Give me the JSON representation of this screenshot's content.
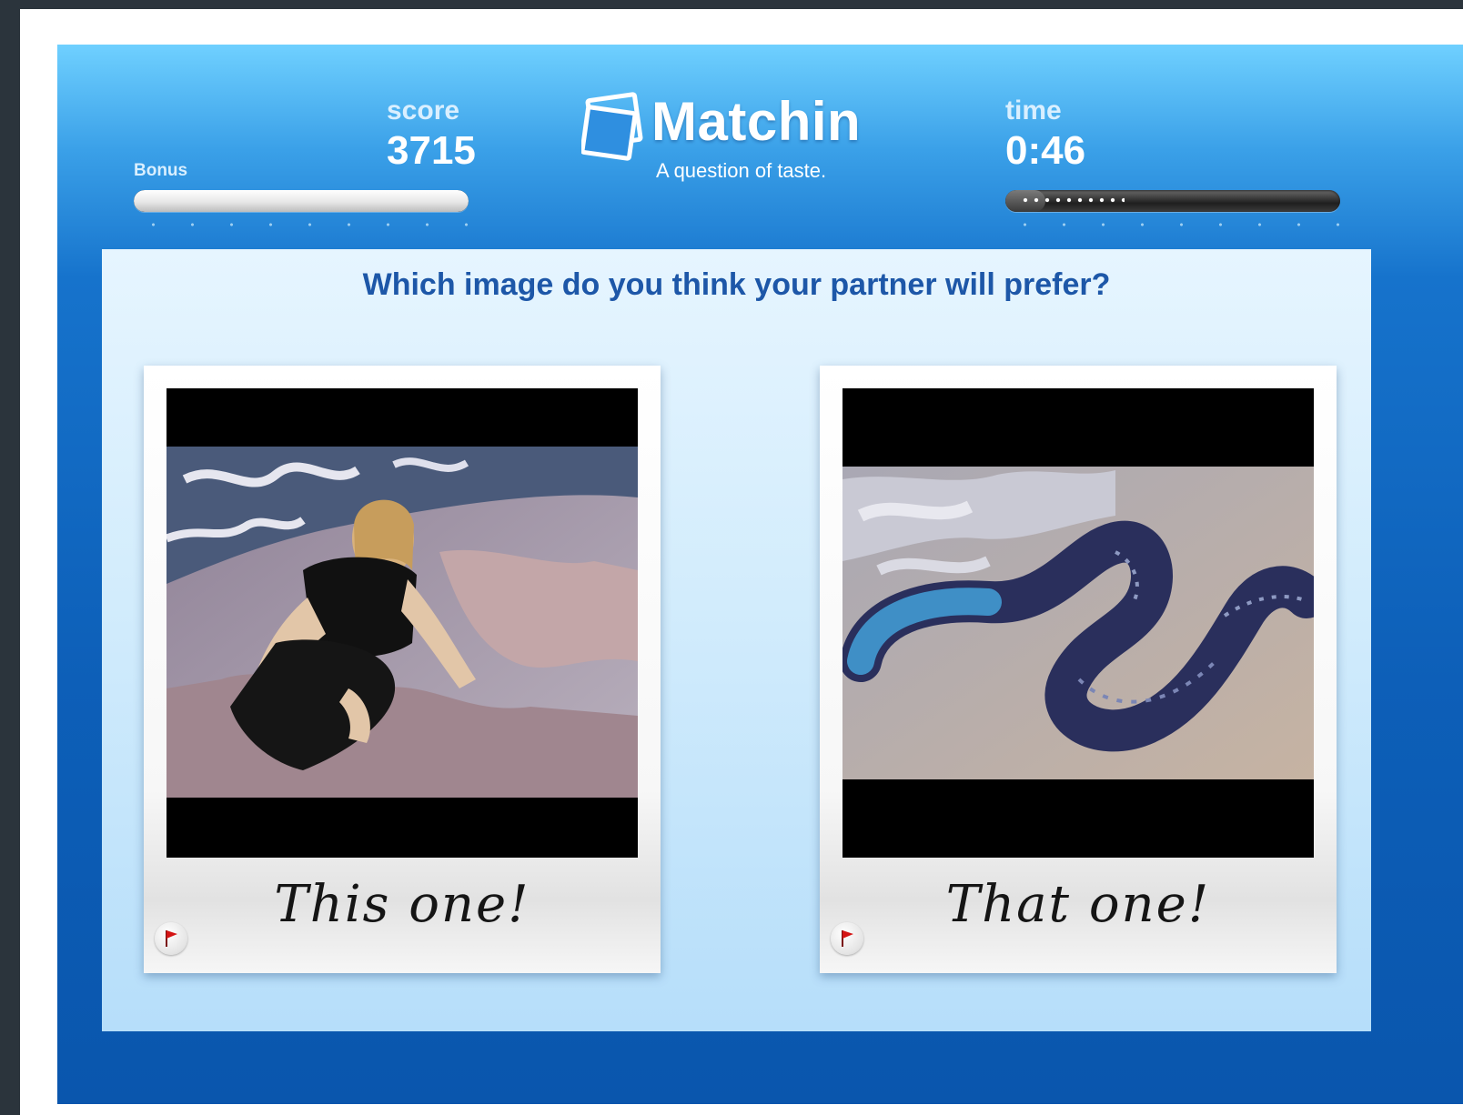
{
  "game": {
    "title": "Matchin",
    "tagline": "A question of taste.",
    "bonus_label": "Bonus",
    "score_label": "score",
    "score_value": "3715",
    "time_label": "time",
    "time_value": "0:46",
    "bonus_fill_fraction": 1.0,
    "time_fill_fraction": 0.12
  },
  "prompt": {
    "question": "Which image do you think your partner will prefer?"
  },
  "choices": [
    {
      "caption": "This one!",
      "image_subject": "woman crouching on a painted map pavement"
    },
    {
      "caption": "That one!",
      "image_subject": "coiled dark snake on a rock"
    }
  ],
  "icons": {
    "flag": "flag-icon",
    "logo": "photos-stack-icon"
  },
  "colors": {
    "accent_blue": "#0d5fb8",
    "question_text": "#1d57a8",
    "flag_red": "#d41414"
  }
}
